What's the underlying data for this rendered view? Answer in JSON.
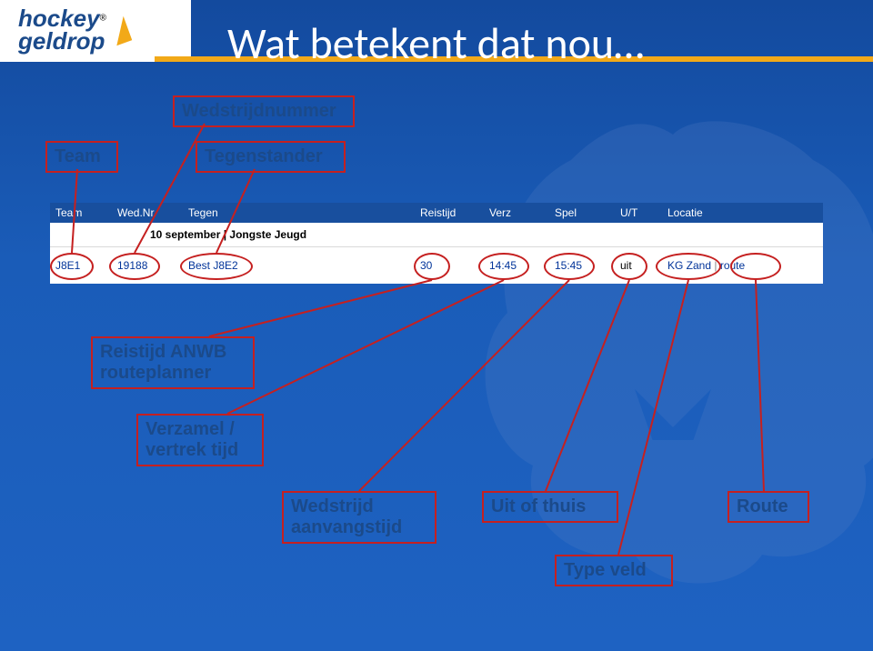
{
  "brand": {
    "line1": "hockey",
    "line2": "geldrop"
  },
  "title": "Wat betekent dat nou…",
  "annotations": {
    "team": "Team",
    "wedstrijdnummer": "Wedstrijdnummer",
    "tegenstander": "Tegenstander",
    "reistijd_anwb": "Reistijd ANWB\nrouteplanner",
    "verzamel": "Verzamel /\nvertrek tijd",
    "wedstrijd_aanvang": "Wedstrijd\naanvangstijd",
    "uit_of_thuis": "Uit of thuis",
    "type_veld": "Type veld",
    "route": "Route"
  },
  "table": {
    "headers": {
      "team": "Team",
      "wednr": "Wed.Nr.",
      "tegen": "Tegen",
      "reistijd": "Reistijd",
      "verz": "Verz",
      "spel": "Spel",
      "ut": "U/T",
      "locatie": "Locatie"
    },
    "date_label": "10 september | Jongste Jeugd",
    "row": {
      "team": "J8E1",
      "wednr": "19188",
      "tegen": "Best J8E2",
      "reistijd": "30",
      "verz": "14:45",
      "spel": "15:45",
      "ut": "uit",
      "loc_veld": "KG Zand",
      "loc_route": "route"
    }
  }
}
